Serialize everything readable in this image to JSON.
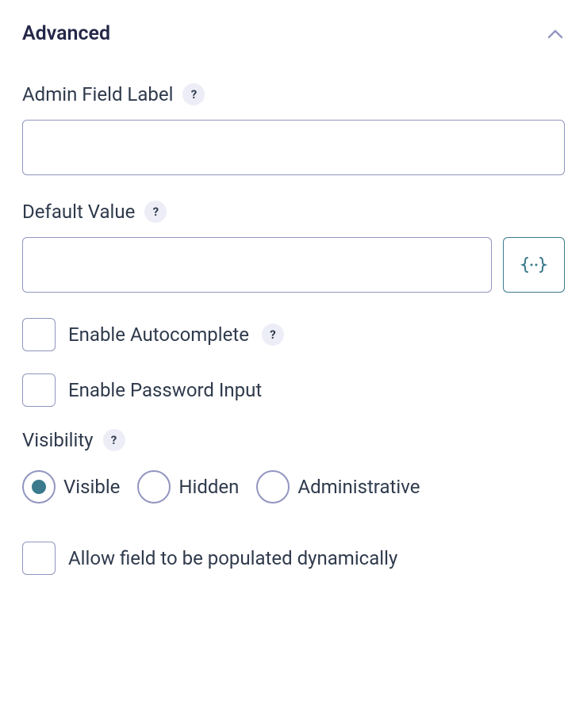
{
  "section": {
    "title": "Advanced"
  },
  "fields": {
    "adminLabel": {
      "label": "Admin Field Label",
      "value": ""
    },
    "defaultValue": {
      "label": "Default Value",
      "value": ""
    }
  },
  "checkboxes": {
    "autocomplete": {
      "label": "Enable Autocomplete",
      "checked": false
    },
    "passwordInput": {
      "label": "Enable Password Input",
      "checked": false
    },
    "populateDynamically": {
      "label": "Allow field to be populated dynamically",
      "checked": false
    }
  },
  "visibility": {
    "label": "Visibility",
    "options": {
      "visible": "Visible",
      "hidden": "Hidden",
      "administrative": "Administrative"
    },
    "selected": "visible"
  }
}
